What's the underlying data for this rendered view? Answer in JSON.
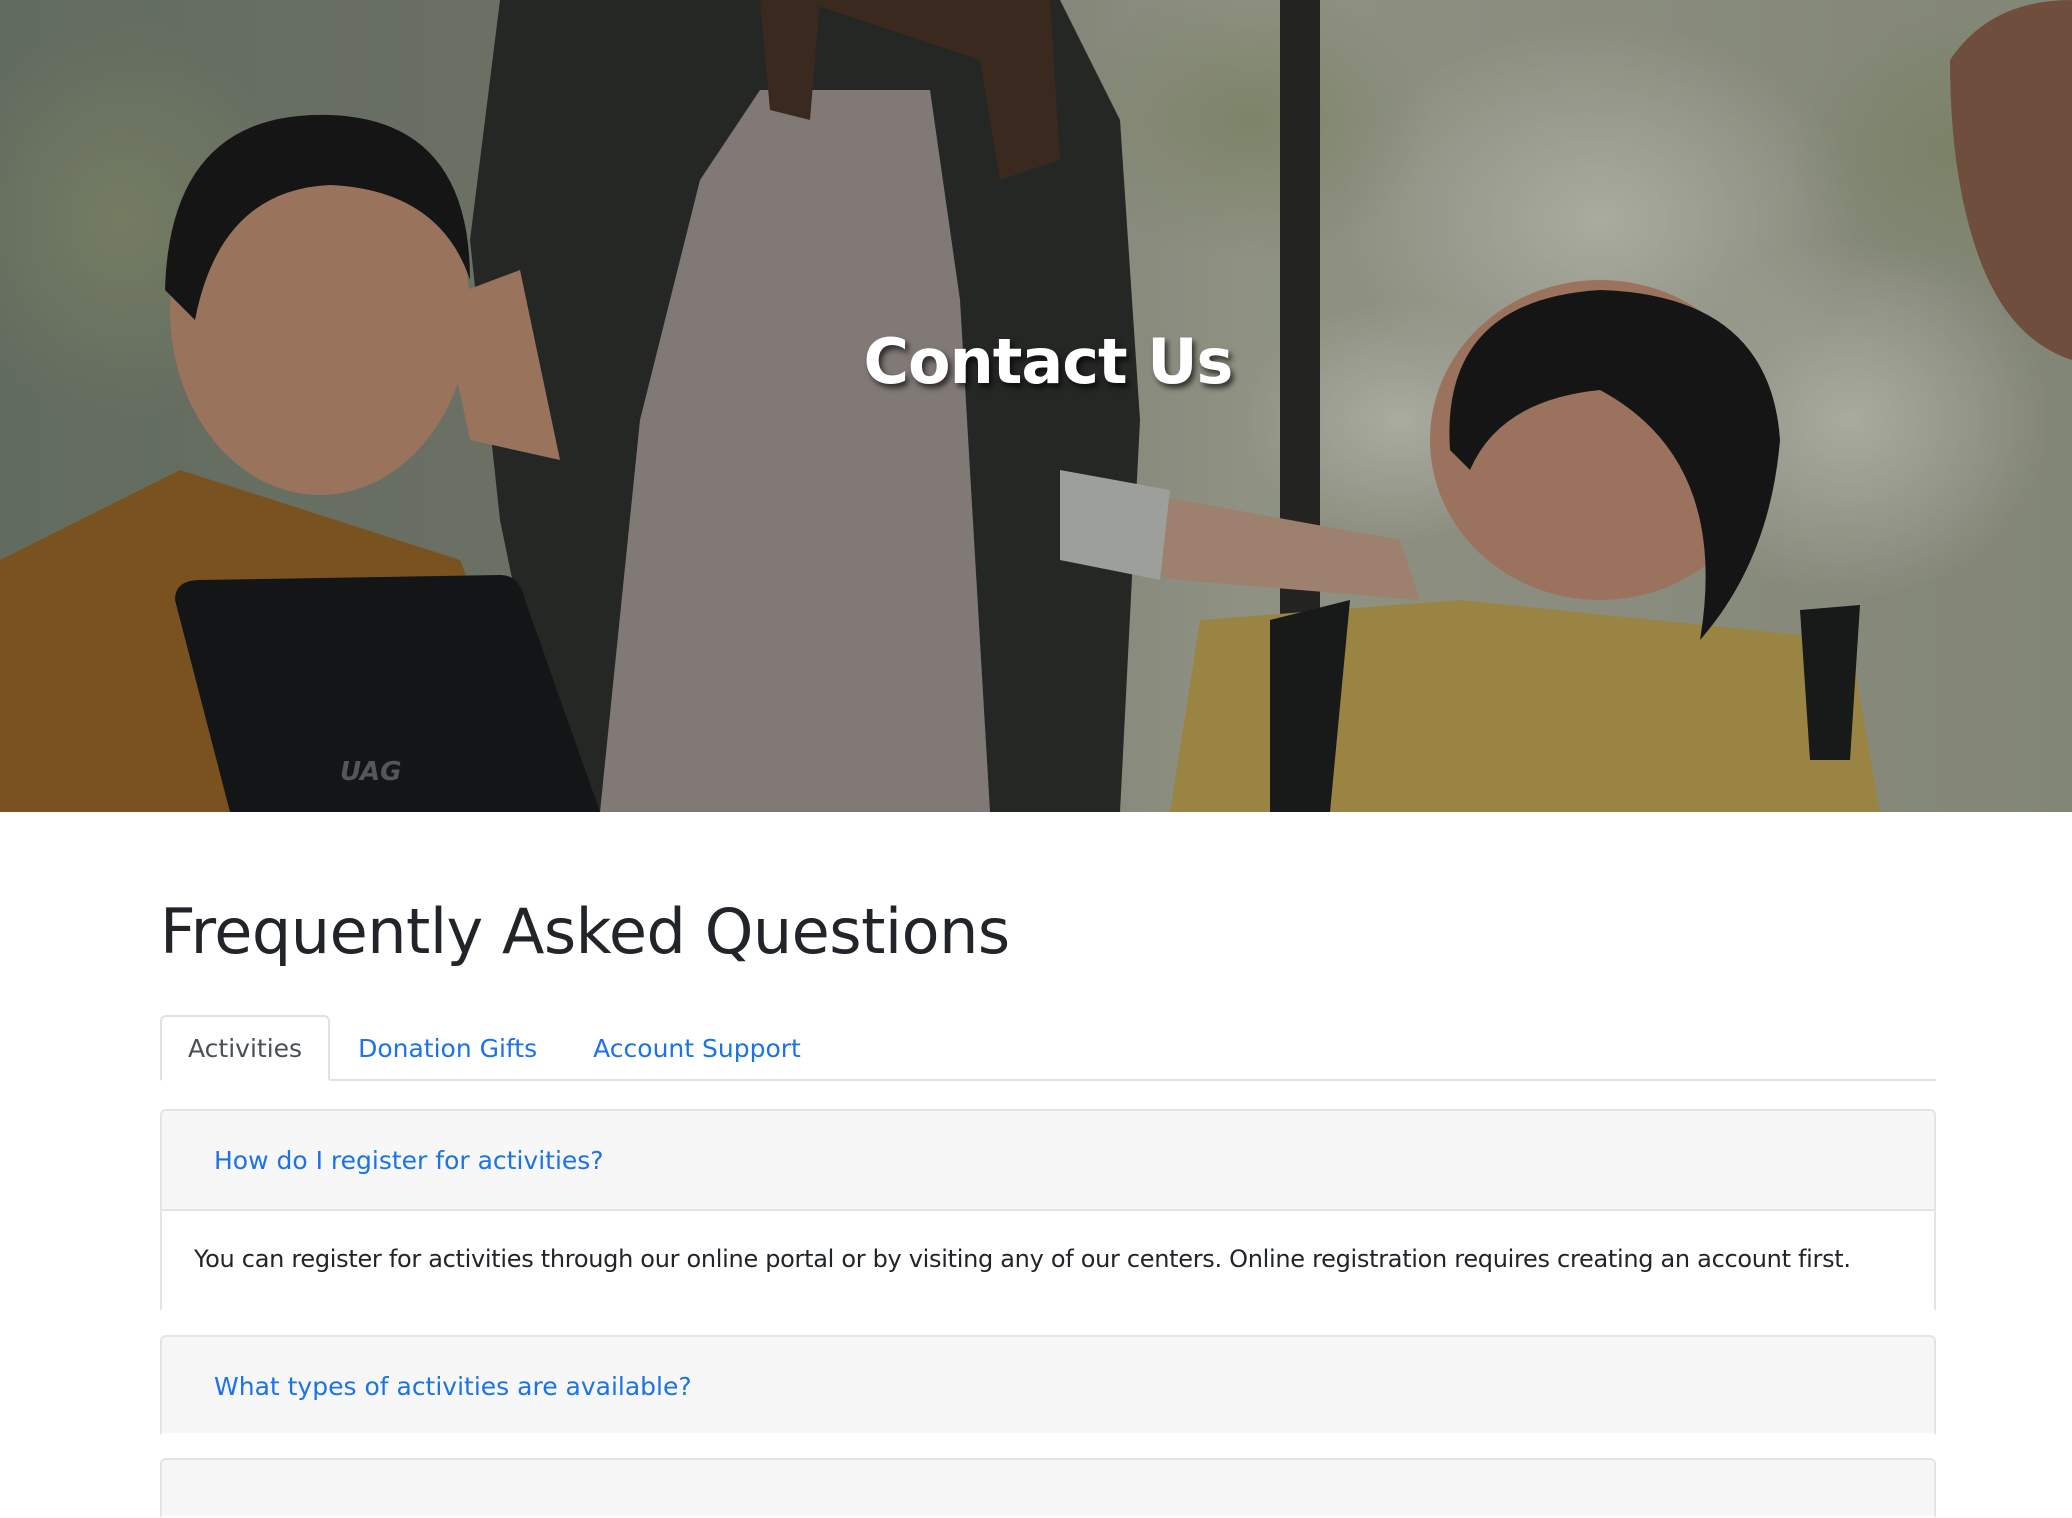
{
  "hero": {
    "title": "Contact Us",
    "image_icon": "people-team-photo",
    "tablet_brand": "UAG"
  },
  "faq": {
    "heading": "Frequently Asked Questions",
    "tabs": [
      {
        "label": "Activities",
        "active": true
      },
      {
        "label": "Donation Gifts",
        "active": false
      },
      {
        "label": "Account Support",
        "active": false
      }
    ],
    "items": [
      {
        "question": "How do I register for activities?",
        "answer": "You can register for activities through our online portal or by visiting any of our centers. Online registration requires creating an account first.",
        "expanded": true
      },
      {
        "question": "What types of activities are available?",
        "expanded": false
      },
      {
        "question": "",
        "expanded": false
      }
    ]
  },
  "colors": {
    "link": "#1a73e8",
    "heading": "#212529",
    "panel_bg": "#f7f7f7",
    "border": "#dee2e6"
  }
}
